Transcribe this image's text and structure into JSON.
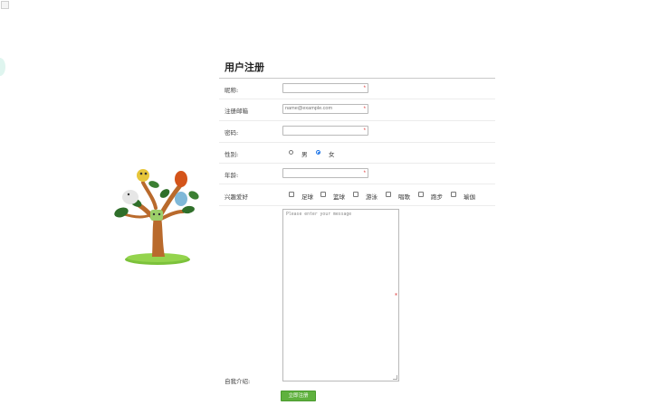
{
  "form": {
    "title": "用户注册",
    "nickname": {
      "label": "昵称:",
      "value": "",
      "required_mark": "*"
    },
    "email": {
      "label": "注册邮箱",
      "placeholder": "name@example.com",
      "required_mark": "*"
    },
    "password": {
      "label": "密码:",
      "value": "",
      "required_mark": "*"
    },
    "gender": {
      "label": "性别:",
      "options": [
        {
          "label": "男",
          "checked": false
        },
        {
          "label": "女",
          "checked": true
        }
      ]
    },
    "age": {
      "label": "年龄:",
      "value": "",
      "required_mark": "*"
    },
    "hobbies": {
      "label": "兴趣爱好",
      "options": [
        "足球",
        "篮球",
        "游泳",
        "唱歌",
        "跑步",
        "瑜伽"
      ]
    },
    "intro": {
      "label": "自我介绍:",
      "placeholder": "Please enter your message",
      "required_mark": "*"
    },
    "submit_label": "立即注册"
  },
  "colors": {
    "accent": "#5fb13e",
    "required": "#d33333",
    "radio_checked": "#1a73e8"
  }
}
